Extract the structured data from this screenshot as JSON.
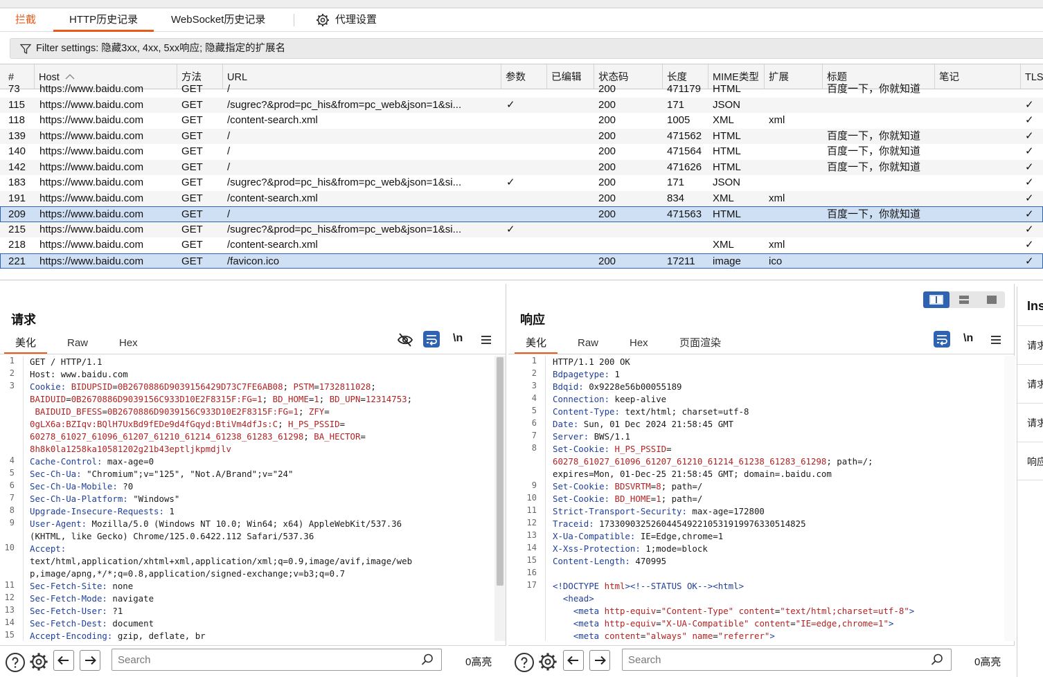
{
  "subtabs": {
    "intercept": "拦截",
    "http_history": "HTTP历史记录",
    "websocket_history": "WebSocket历史记录",
    "proxy_settings": "代理设置"
  },
  "filter": {
    "text": "Filter settings: 隐藏3xx, 4xx, 5xx响应; 隐藏指定的扩展名"
  },
  "table": {
    "columns": [
      "#",
      "Host",
      "方法",
      "URL",
      "参数",
      "已编辑",
      "状态码",
      "长度",
      "MIME类型",
      "扩展",
      "标题",
      "笔记",
      "TLS"
    ],
    "partial_row": {
      "num": "73",
      "host": "https://www.baidu.com",
      "method": "GET",
      "url": "/",
      "status": "200",
      "length": "471179",
      "mime": "HTML",
      "title": "百度一下，你就知道"
    },
    "rows": [
      {
        "num": "115",
        "host": "https://www.baidu.com",
        "method": "GET",
        "url": "/sugrec?&prod=pc_his&from=pc_web&json=1&si...",
        "params": "✓",
        "status": "200",
        "length": "171",
        "mime": "JSON",
        "ext": "",
        "title": "",
        "tls": "✓"
      },
      {
        "num": "118",
        "host": "https://www.baidu.com",
        "method": "GET",
        "url": "/content-search.xml",
        "params": "",
        "status": "200",
        "length": "1005",
        "mime": "XML",
        "ext": "xml",
        "title": "",
        "tls": "✓"
      },
      {
        "num": "139",
        "host": "https://www.baidu.com",
        "method": "GET",
        "url": "/",
        "params": "",
        "status": "200",
        "length": "471562",
        "mime": "HTML",
        "ext": "",
        "title": "百度一下，你就知道",
        "tls": "✓"
      },
      {
        "num": "140",
        "host": "https://www.baidu.com",
        "method": "GET",
        "url": "/",
        "params": "",
        "status": "200",
        "length": "471564",
        "mime": "HTML",
        "ext": "",
        "title": "百度一下，你就知道",
        "tls": "✓"
      },
      {
        "num": "142",
        "host": "https://www.baidu.com",
        "method": "GET",
        "url": "/",
        "params": "",
        "status": "200",
        "length": "471626",
        "mime": "HTML",
        "ext": "",
        "title": "百度一下，你就知道",
        "tls": "✓"
      },
      {
        "num": "183",
        "host": "https://www.baidu.com",
        "method": "GET",
        "url": "/sugrec?&prod=pc_his&from=pc_web&json=1&si...",
        "params": "✓",
        "status": "200",
        "length": "171",
        "mime": "JSON",
        "ext": "",
        "title": "",
        "tls": "✓"
      },
      {
        "num": "191",
        "host": "https://www.baidu.com",
        "method": "GET",
        "url": "/content-search.xml",
        "params": "",
        "status": "200",
        "length": "834",
        "mime": "XML",
        "ext": "xml",
        "title": "",
        "tls": "✓"
      },
      {
        "num": "209",
        "host": "https://www.baidu.com",
        "method": "GET",
        "url": "/",
        "params": "",
        "status": "200",
        "length": "471563",
        "mime": "HTML",
        "ext": "",
        "title": "百度一下，你就知道",
        "tls": "✓"
      },
      {
        "num": "215",
        "host": "https://www.baidu.com",
        "method": "GET",
        "url": "/sugrec?&prod=pc_his&from=pc_web&json=1&si...",
        "params": "✓",
        "status": "",
        "length": "",
        "mime": "",
        "ext": "",
        "title": "",
        "tls": "✓"
      },
      {
        "num": "218",
        "host": "https://www.baidu.com",
        "method": "GET",
        "url": "/content-search.xml",
        "params": "",
        "status": "",
        "length": "",
        "mime": "XML",
        "ext": "xml",
        "title": "",
        "tls": "✓"
      },
      {
        "num": "221",
        "host": "https://www.baidu.com",
        "method": "GET",
        "url": "/favicon.ico",
        "params": "",
        "status": "200",
        "length": "17211",
        "mime": "image",
        "ext": "ico",
        "title": "",
        "tls": "✓"
      }
    ]
  },
  "request": {
    "title": "请求",
    "tabs": [
      "美化",
      "Raw",
      "Hex"
    ],
    "newline_label": "\\n",
    "gutter": [
      "1",
      "2",
      "3",
      "",
      "",
      "",
      "",
      "",
      "4",
      "5",
      "6",
      "7",
      "8",
      "9",
      "",
      "10",
      "",
      "",
      "11",
      "12",
      "13",
      "14",
      "15"
    ],
    "lines": [
      [
        [
          "t",
          "GET / HTTP/1.1"
        ]
      ],
      [
        [
          "t",
          "Host: www.baidu.com"
        ]
      ],
      [
        [
          "k",
          "Cookie: "
        ],
        [
          "v",
          "BIDUPSID"
        ],
        [
          "t",
          "="
        ],
        [
          "v",
          "0B2670886D9039156429D73C7FE6AB08"
        ],
        [
          "t",
          "; "
        ],
        [
          "v",
          "PSTM"
        ],
        [
          "t",
          "="
        ],
        [
          "v",
          "1732811028"
        ],
        [
          "t",
          ";"
        ]
      ],
      [
        [
          "v",
          "BAIDUID"
        ],
        [
          "t",
          "="
        ],
        [
          "v",
          "0B2670886D9039156C933D10E2F8315F:FG=1"
        ],
        [
          "t",
          "; "
        ],
        [
          "v",
          "BD_HOME"
        ],
        [
          "t",
          "="
        ],
        [
          "v",
          "1"
        ],
        [
          "t",
          "; "
        ],
        [
          "v",
          "BD_UPN"
        ],
        [
          "t",
          "="
        ],
        [
          "v",
          "12314753"
        ],
        [
          "t",
          ";"
        ]
      ],
      [
        [
          "t",
          " "
        ],
        [
          "v",
          "BAIDUID_BFESS"
        ],
        [
          "t",
          "="
        ],
        [
          "v",
          "0B2670886D9039156C933D10E2F8315F:FG=1"
        ],
        [
          "t",
          "; "
        ],
        [
          "v",
          "ZFY"
        ],
        [
          "t",
          "="
        ]
      ],
      [
        [
          "v",
          "0gLX6a:BZIqv:BQlH7UxBd9fEDe9d4fGqyd:BtiVm4dfJs:C"
        ],
        [
          "t",
          "; "
        ],
        [
          "v",
          "H_PS_PSSID"
        ],
        [
          "t",
          "="
        ]
      ],
      [
        [
          "v",
          "60278_61027_61096_61207_61210_61214_61238_61283_61298"
        ],
        [
          "t",
          "; "
        ],
        [
          "v",
          "BA_HECTOR"
        ],
        [
          "t",
          "="
        ]
      ],
      [
        [
          "v",
          "8h8k0la1258ka10581202g21b43eptljkpmdjlv"
        ]
      ],
      [
        [
          "k",
          "Cache-Control: "
        ],
        [
          "t",
          "max-age=0"
        ]
      ],
      [
        [
          "k",
          "Sec-Ch-Ua: "
        ],
        [
          "t",
          "\"Chromium\";v=\"125\", \"Not.A/Brand\";v=\"24\""
        ]
      ],
      [
        [
          "k",
          "Sec-Ch-Ua-Mobile: "
        ],
        [
          "t",
          "?0"
        ]
      ],
      [
        [
          "k",
          "Sec-Ch-Ua-Platform: "
        ],
        [
          "t",
          "\"Windows\""
        ]
      ],
      [
        [
          "k",
          "Upgrade-Insecure-Requests: "
        ],
        [
          "t",
          "1"
        ]
      ],
      [
        [
          "k",
          "User-Agent: "
        ],
        [
          "t",
          "Mozilla/5.0 (Windows NT 10.0; Win64; x64) AppleWebKit/537.36"
        ]
      ],
      [
        [
          "t",
          "(KHTML, like Gecko) Chrome/125.0.6422.112 Safari/537.36"
        ]
      ],
      [
        [
          "k",
          "Accept: "
        ]
      ],
      [
        [
          "t",
          "text/html,application/xhtml+xml,application/xml;q=0.9,image/avif,image/web"
        ]
      ],
      [
        [
          "t",
          "p,image/apng,*/*;q=0.8,application/signed-exchange;v=b3;q=0.7"
        ]
      ],
      [
        [
          "k",
          "Sec-Fetch-Site: "
        ],
        [
          "t",
          "none"
        ]
      ],
      [
        [
          "k",
          "Sec-Fetch-Mode: "
        ],
        [
          "t",
          "navigate"
        ]
      ],
      [
        [
          "k",
          "Sec-Fetch-User: "
        ],
        [
          "t",
          "?1"
        ]
      ],
      [
        [
          "k",
          "Sec-Fetch-Dest: "
        ],
        [
          "t",
          "document"
        ]
      ],
      [
        [
          "k",
          "Accept-Encoding: "
        ],
        [
          "t",
          "gzip, deflate, br"
        ]
      ]
    ],
    "search_placeholder": "Search",
    "highlight_count": "0高亮"
  },
  "response": {
    "title": "响应",
    "tabs": [
      "美化",
      "Raw",
      "Hex",
      "页面渲染"
    ],
    "newline_label": "\\n",
    "gutter": [
      "1",
      "2",
      "3",
      "4",
      "5",
      "6",
      "7",
      "8",
      "",
      "",
      "9",
      "10",
      "11",
      "12",
      "13",
      "14",
      "15",
      "16",
      "17",
      "",
      "",
      "",
      ""
    ],
    "lines": [
      [
        [
          "t",
          "HTTP/1.1 200 OK"
        ]
      ],
      [
        [
          "k",
          "Bdpagetype: "
        ],
        [
          "t",
          "1"
        ]
      ],
      [
        [
          "k",
          "Bdqid: "
        ],
        [
          "t",
          "0x9228e56b00055189"
        ]
      ],
      [
        [
          "k",
          "Connection: "
        ],
        [
          "t",
          "keep-alive"
        ]
      ],
      [
        [
          "k",
          "Content-Type: "
        ],
        [
          "t",
          "text/html; charset=utf-8"
        ]
      ],
      [
        [
          "k",
          "Date: "
        ],
        [
          "t",
          "Sun, 01 Dec 2024 21:58:45 GMT"
        ]
      ],
      [
        [
          "k",
          "Server: "
        ],
        [
          "t",
          "BWS/1.1"
        ]
      ],
      [
        [
          "k",
          "Set-Cookie: "
        ],
        [
          "v",
          "H_PS_PSSID"
        ],
        [
          "t",
          "="
        ]
      ],
      [
        [
          "v",
          "60278_61027_61096_61207_61210_61214_61238_61283_61298"
        ],
        [
          "t",
          "; path=/;"
        ]
      ],
      [
        [
          "t",
          "expires=Mon, 01-Dec-25 21:58:45 GMT; domain=.baidu.com"
        ]
      ],
      [
        [
          "k",
          "Set-Cookie: "
        ],
        [
          "v",
          "BDSVRTM"
        ],
        [
          "t",
          "="
        ],
        [
          "v",
          "8"
        ],
        [
          "t",
          "; path=/"
        ]
      ],
      [
        [
          "k",
          "Set-Cookie: "
        ],
        [
          "v",
          "BD_HOME"
        ],
        [
          "t",
          "="
        ],
        [
          "v",
          "1"
        ],
        [
          "t",
          "; path=/"
        ]
      ],
      [
        [
          "k",
          "Strict-Transport-Security: "
        ],
        [
          "t",
          "max-age=172800"
        ]
      ],
      [
        [
          "k",
          "Traceid: "
        ],
        [
          "t",
          "1733090325260445492210531919976330514825"
        ]
      ],
      [
        [
          "k",
          "X-Ua-Compatible: "
        ],
        [
          "t",
          "IE=Edge,chrome=1"
        ]
      ],
      [
        [
          "k",
          "X-Xss-Protection: "
        ],
        [
          "t",
          "1;mode=block"
        ]
      ],
      [
        [
          "k",
          "Content-Length: "
        ],
        [
          "t",
          "470995"
        ]
      ],
      [
        [
          "t",
          ""
        ]
      ],
      [
        [
          "tag",
          "<!DOCTYPE "
        ],
        [
          "at",
          "html"
        ],
        [
          "tag",
          "><!--STATUS OK--><html>"
        ]
      ],
      [
        [
          "t",
          "  "
        ],
        [
          "tag",
          "<head>"
        ]
      ],
      [
        [
          "t",
          "    "
        ],
        [
          "tag",
          "<meta "
        ],
        [
          "at",
          "http-equiv"
        ],
        [
          "t",
          "="
        ],
        [
          "v",
          "\"Content-Type\""
        ],
        [
          "t",
          " "
        ],
        [
          "at",
          "content"
        ],
        [
          "t",
          "="
        ],
        [
          "v",
          "\"text/html;charset=utf-8\""
        ],
        [
          "tag",
          ">"
        ]
      ],
      [
        [
          "t",
          "    "
        ],
        [
          "tag",
          "<meta "
        ],
        [
          "at",
          "http-equiv"
        ],
        [
          "t",
          "="
        ],
        [
          "v",
          "\"X-UA-Compatible\""
        ],
        [
          "t",
          " "
        ],
        [
          "at",
          "content"
        ],
        [
          "t",
          "="
        ],
        [
          "v",
          "\"IE=edge,chrome=1\""
        ],
        [
          "tag",
          ">"
        ]
      ],
      [
        [
          "t",
          "    "
        ],
        [
          "tag",
          "<meta "
        ],
        [
          "at",
          "content"
        ],
        [
          "t",
          "="
        ],
        [
          "v",
          "\"always\""
        ],
        [
          "t",
          " "
        ],
        [
          "at",
          "name"
        ],
        [
          "t",
          "="
        ],
        [
          "v",
          "\"referrer\""
        ],
        [
          "tag",
          ">"
        ]
      ]
    ],
    "search_placeholder": "Search",
    "highlight_count": "0高亮"
  },
  "inspector": {
    "title": "Ins",
    "items": [
      "请求",
      "请求",
      "请求",
      "响应"
    ]
  },
  "colors": {
    "accent": "#e8591a",
    "selection": "#cfe0f5",
    "selection_border": "#2f62b0",
    "header_key": "#1f3f9a",
    "cookie_value": "#b22222"
  }
}
